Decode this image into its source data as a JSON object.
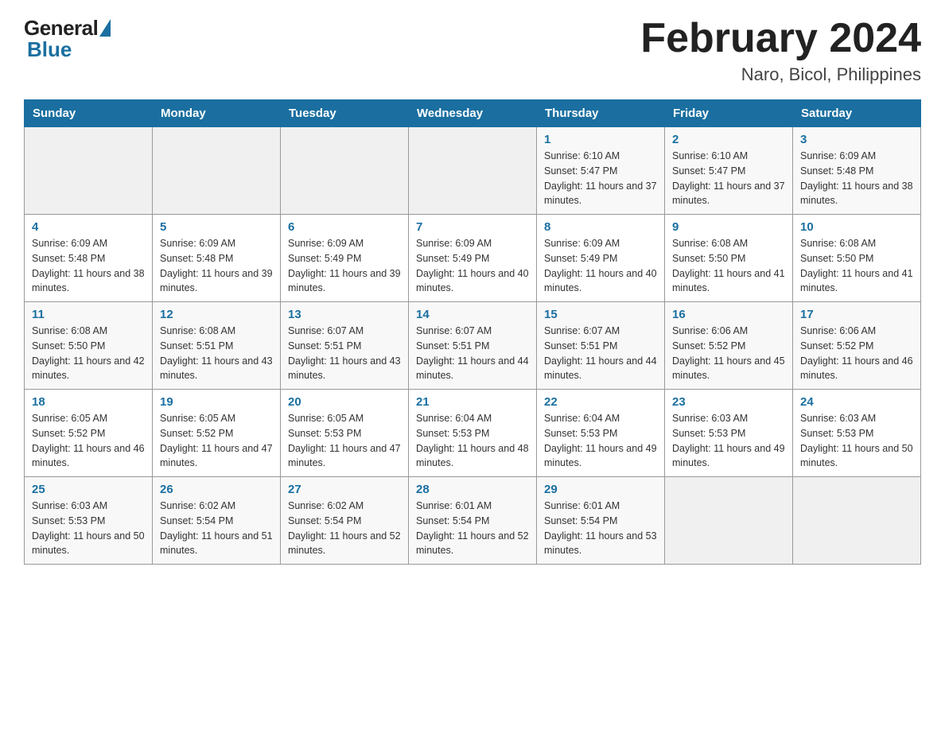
{
  "header": {
    "logo_general": "General",
    "logo_blue": "Blue",
    "month_title": "February 2024",
    "location": "Naro, Bicol, Philippines"
  },
  "calendar": {
    "weekdays": [
      "Sunday",
      "Monday",
      "Tuesday",
      "Wednesday",
      "Thursday",
      "Friday",
      "Saturday"
    ],
    "weeks": [
      [
        {
          "day": "",
          "info": ""
        },
        {
          "day": "",
          "info": ""
        },
        {
          "day": "",
          "info": ""
        },
        {
          "day": "",
          "info": ""
        },
        {
          "day": "1",
          "info": "Sunrise: 6:10 AM\nSunset: 5:47 PM\nDaylight: 11 hours and 37 minutes."
        },
        {
          "day": "2",
          "info": "Sunrise: 6:10 AM\nSunset: 5:47 PM\nDaylight: 11 hours and 37 minutes."
        },
        {
          "day": "3",
          "info": "Sunrise: 6:09 AM\nSunset: 5:48 PM\nDaylight: 11 hours and 38 minutes."
        }
      ],
      [
        {
          "day": "4",
          "info": "Sunrise: 6:09 AM\nSunset: 5:48 PM\nDaylight: 11 hours and 38 minutes."
        },
        {
          "day": "5",
          "info": "Sunrise: 6:09 AM\nSunset: 5:48 PM\nDaylight: 11 hours and 39 minutes."
        },
        {
          "day": "6",
          "info": "Sunrise: 6:09 AM\nSunset: 5:49 PM\nDaylight: 11 hours and 39 minutes."
        },
        {
          "day": "7",
          "info": "Sunrise: 6:09 AM\nSunset: 5:49 PM\nDaylight: 11 hours and 40 minutes."
        },
        {
          "day": "8",
          "info": "Sunrise: 6:09 AM\nSunset: 5:49 PM\nDaylight: 11 hours and 40 minutes."
        },
        {
          "day": "9",
          "info": "Sunrise: 6:08 AM\nSunset: 5:50 PM\nDaylight: 11 hours and 41 minutes."
        },
        {
          "day": "10",
          "info": "Sunrise: 6:08 AM\nSunset: 5:50 PM\nDaylight: 11 hours and 41 minutes."
        }
      ],
      [
        {
          "day": "11",
          "info": "Sunrise: 6:08 AM\nSunset: 5:50 PM\nDaylight: 11 hours and 42 minutes."
        },
        {
          "day": "12",
          "info": "Sunrise: 6:08 AM\nSunset: 5:51 PM\nDaylight: 11 hours and 43 minutes."
        },
        {
          "day": "13",
          "info": "Sunrise: 6:07 AM\nSunset: 5:51 PM\nDaylight: 11 hours and 43 minutes."
        },
        {
          "day": "14",
          "info": "Sunrise: 6:07 AM\nSunset: 5:51 PM\nDaylight: 11 hours and 44 minutes."
        },
        {
          "day": "15",
          "info": "Sunrise: 6:07 AM\nSunset: 5:51 PM\nDaylight: 11 hours and 44 minutes."
        },
        {
          "day": "16",
          "info": "Sunrise: 6:06 AM\nSunset: 5:52 PM\nDaylight: 11 hours and 45 minutes."
        },
        {
          "day": "17",
          "info": "Sunrise: 6:06 AM\nSunset: 5:52 PM\nDaylight: 11 hours and 46 minutes."
        }
      ],
      [
        {
          "day": "18",
          "info": "Sunrise: 6:05 AM\nSunset: 5:52 PM\nDaylight: 11 hours and 46 minutes."
        },
        {
          "day": "19",
          "info": "Sunrise: 6:05 AM\nSunset: 5:52 PM\nDaylight: 11 hours and 47 minutes."
        },
        {
          "day": "20",
          "info": "Sunrise: 6:05 AM\nSunset: 5:53 PM\nDaylight: 11 hours and 47 minutes."
        },
        {
          "day": "21",
          "info": "Sunrise: 6:04 AM\nSunset: 5:53 PM\nDaylight: 11 hours and 48 minutes."
        },
        {
          "day": "22",
          "info": "Sunrise: 6:04 AM\nSunset: 5:53 PM\nDaylight: 11 hours and 49 minutes."
        },
        {
          "day": "23",
          "info": "Sunrise: 6:03 AM\nSunset: 5:53 PM\nDaylight: 11 hours and 49 minutes."
        },
        {
          "day": "24",
          "info": "Sunrise: 6:03 AM\nSunset: 5:53 PM\nDaylight: 11 hours and 50 minutes."
        }
      ],
      [
        {
          "day": "25",
          "info": "Sunrise: 6:03 AM\nSunset: 5:53 PM\nDaylight: 11 hours and 50 minutes."
        },
        {
          "day": "26",
          "info": "Sunrise: 6:02 AM\nSunset: 5:54 PM\nDaylight: 11 hours and 51 minutes."
        },
        {
          "day": "27",
          "info": "Sunrise: 6:02 AM\nSunset: 5:54 PM\nDaylight: 11 hours and 52 minutes."
        },
        {
          "day": "28",
          "info": "Sunrise: 6:01 AM\nSunset: 5:54 PM\nDaylight: 11 hours and 52 minutes."
        },
        {
          "day": "29",
          "info": "Sunrise: 6:01 AM\nSunset: 5:54 PM\nDaylight: 11 hours and 53 minutes."
        },
        {
          "day": "",
          "info": ""
        },
        {
          "day": "",
          "info": ""
        }
      ]
    ]
  }
}
